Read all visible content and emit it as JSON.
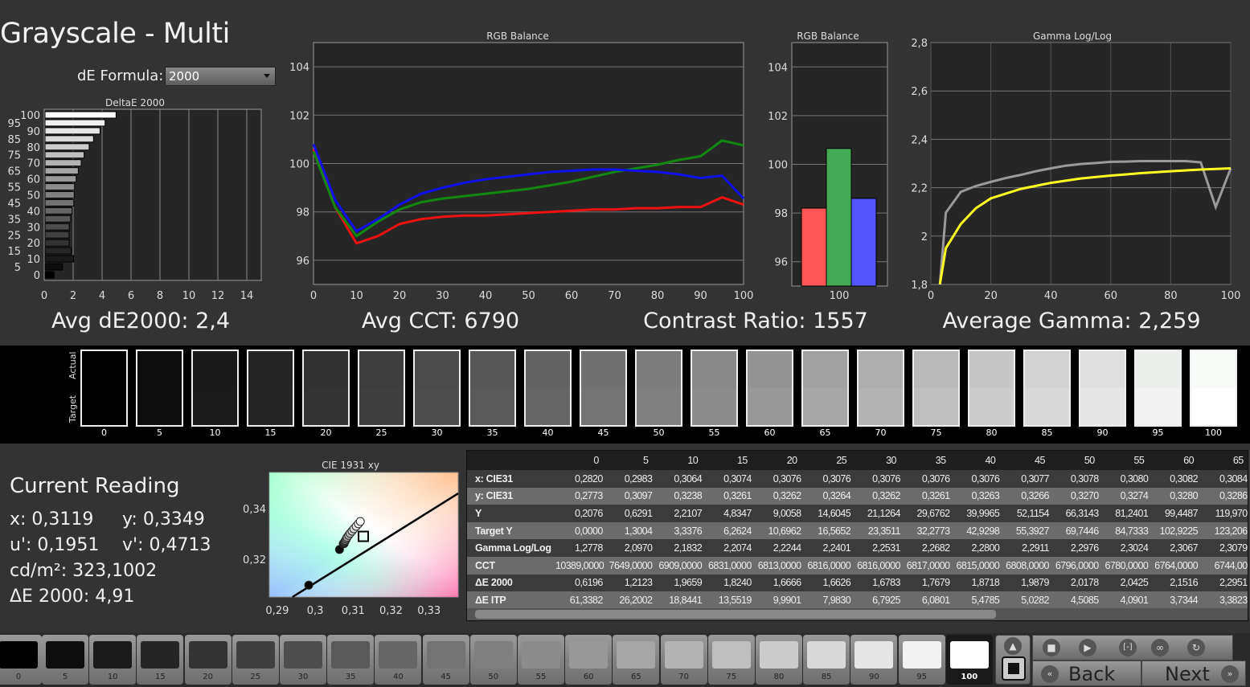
{
  "title": "Grayscale - Multi",
  "de_formula": {
    "label": "dE Formula:",
    "value": "2000"
  },
  "stats": {
    "avg_de": "Avg dE2000: 2,4",
    "avg_cct": "Avg CCT: 6790",
    "contrast": "Contrast Ratio: 1557",
    "avg_gamma": "Average Gamma: 2,259"
  },
  "colors": {
    "red": "#ee1111",
    "green": "#118811",
    "blue": "#1111ee",
    "gamma_actual": "#9a9a9a",
    "gamma_target": "#ffff22",
    "bar_red": "#ff5555",
    "bar_green": "#44aa55",
    "bar_blue": "#5555ff"
  },
  "chart_data": [
    {
      "type": "bar",
      "orientation": "horizontal",
      "title": "DeltaE 2000",
      "categories": [
        "0",
        "5",
        "10",
        "15",
        "20",
        "25",
        "30",
        "35",
        "40",
        "45",
        "50",
        "55",
        "60",
        "65",
        "70",
        "75",
        "80",
        "85",
        "90",
        "95",
        "100"
      ],
      "y_tick_labels": [
        "0",
        "5",
        "10",
        "15",
        "20",
        "25",
        "30",
        "35",
        "40",
        "45",
        "50",
        "55",
        "60",
        "65",
        "70",
        "75",
        "80",
        "85",
        "90",
        "95",
        "100"
      ],
      "values": [
        0.62,
        1.21,
        1.97,
        1.82,
        1.67,
        1.66,
        1.68,
        1.77,
        1.87,
        1.99,
        2.02,
        2.04,
        2.15,
        2.3,
        2.5,
        2.7,
        3.05,
        3.35,
        3.8,
        4.15,
        4.91
      ],
      "xlim": [
        0,
        15
      ],
      "x_ticks": [
        "0",
        "2",
        "4",
        "6",
        "8",
        "10",
        "12",
        "14"
      ],
      "grid": true
    },
    {
      "type": "line",
      "title": "RGB Balance",
      "x": [
        0,
        5,
        10,
        15,
        20,
        25,
        30,
        35,
        40,
        45,
        50,
        55,
        60,
        65,
        70,
        75,
        80,
        85,
        90,
        95,
        100
      ],
      "xlim": [
        0,
        100
      ],
      "ylim": [
        95,
        105
      ],
      "x_ticks": [
        "0",
        "10",
        "20",
        "30",
        "40",
        "50",
        "60",
        "70",
        "80",
        "90",
        "100"
      ],
      "y_ticks": [
        "96",
        "98",
        "100",
        "102",
        "104"
      ],
      "grid": true,
      "series": [
        {
          "color": "red",
          "values": [
            100.6,
            98.2,
            96.7,
            97.0,
            97.5,
            97.7,
            97.8,
            97.85,
            97.85,
            97.9,
            97.95,
            98.0,
            98.05,
            98.1,
            98.1,
            98.15,
            98.15,
            98.2,
            98.2,
            98.6,
            98.3
          ]
        },
        {
          "color": "green",
          "values": [
            100.5,
            98.2,
            97.0,
            97.6,
            98.1,
            98.4,
            98.55,
            98.65,
            98.75,
            98.85,
            98.95,
            99.1,
            99.25,
            99.45,
            99.65,
            99.8,
            99.95,
            100.15,
            100.3,
            100.95,
            100.75
          ]
        },
        {
          "color": "blue",
          "values": [
            100.8,
            98.5,
            97.2,
            97.7,
            98.3,
            98.75,
            99.0,
            99.2,
            99.35,
            99.45,
            99.55,
            99.65,
            99.7,
            99.75,
            99.75,
            99.7,
            99.65,
            99.55,
            99.4,
            99.5,
            98.55
          ]
        }
      ]
    },
    {
      "type": "bar",
      "title": "RGB Balance",
      "categories": [
        "100"
      ],
      "ylim": [
        95,
        105
      ],
      "y_ticks": [
        "96",
        "98",
        "100",
        "102",
        "104"
      ],
      "series": [
        {
          "color": "red",
          "values": [
            98.2
          ]
        },
        {
          "color": "green",
          "values": [
            100.65
          ]
        },
        {
          "color": "blue",
          "values": [
            98.6
          ]
        }
      ]
    },
    {
      "type": "line",
      "title": "Gamma Log/Log",
      "xlim": [
        0,
        100
      ],
      "ylim": [
        1.8,
        2.8
      ],
      "x_ticks": [
        "0",
        "20",
        "40",
        "60",
        "80",
        "100"
      ],
      "y_ticks": [
        "1,8",
        "2",
        "2,2",
        "2,4",
        "2,6",
        "2,8"
      ],
      "grid": true,
      "series": [
        {
          "color": "gray",
          "x": [
            3,
            5,
            10,
            15,
            20,
            25,
            30,
            35,
            40,
            45,
            50,
            55,
            60,
            65,
            70,
            75,
            80,
            85,
            90,
            95,
            100
          ],
          "values": [
            1.8,
            2.097,
            2.183,
            2.207,
            2.224,
            2.24,
            2.253,
            2.268,
            2.28,
            2.291,
            2.298,
            2.302,
            2.307,
            2.308,
            2.31,
            2.31,
            2.31,
            2.31,
            2.305,
            2.12,
            2.28
          ]
        },
        {
          "color": "yellow",
          "x": [
            3,
            5,
            10,
            15,
            20,
            30,
            40,
            50,
            60,
            70,
            80,
            90,
            100
          ],
          "values": [
            1.8,
            1.95,
            2.05,
            2.115,
            2.156,
            2.195,
            2.22,
            2.238,
            2.25,
            2.26,
            2.268,
            2.275,
            2.28
          ]
        }
      ]
    },
    {
      "type": "scatter",
      "title": "CIE 1931 xy",
      "xlim": [
        0.2879,
        0.3377
      ],
      "ylim": [
        0.305,
        0.3543
      ],
      "x_ticks": [
        "0,29",
        "0,3",
        "0,31",
        "0,32",
        "0,33"
      ],
      "y_ticks": [
        "0,32",
        "0,34"
      ],
      "points": [
        [
          0.2983,
          0.3097
        ],
        [
          0.3064,
          0.3238
        ],
        [
          0.3074,
          0.3261
        ],
        [
          0.3076,
          0.3262
        ],
        [
          0.3076,
          0.3264
        ],
        [
          0.3076,
          0.3262
        ],
        [
          0.3076,
          0.3261
        ],
        [
          0.3076,
          0.3263
        ],
        [
          0.3077,
          0.3266
        ],
        [
          0.3078,
          0.327
        ],
        [
          0.308,
          0.3274
        ],
        [
          0.3082,
          0.328
        ],
        [
          0.3084,
          0.3286
        ],
        [
          0.3088,
          0.3294
        ],
        [
          0.3092,
          0.3302
        ],
        [
          0.3097,
          0.3311
        ],
        [
          0.3102,
          0.332
        ],
        [
          0.3108,
          0.333
        ],
        [
          0.3114,
          0.334
        ],
        [
          0.3119,
          0.3349
        ]
      ],
      "target": [
        0.3127,
        0.329
      ],
      "locus": [
        [
          0.294,
          0.305
        ],
        [
          0.3377,
          0.346
        ]
      ]
    }
  ],
  "swatches": {
    "actual_label": "Actual",
    "target_label": "Target",
    "levels": [
      "0",
      "5",
      "10",
      "15",
      "20",
      "25",
      "30",
      "35",
      "40",
      "45",
      "50",
      "55",
      "60",
      "65",
      "70",
      "75",
      "80",
      "85",
      "90",
      "95",
      "100"
    ]
  },
  "current_reading": {
    "title": "Current Reading",
    "x": "x: 0,3119",
    "y": "y: 0,3349",
    "u": "u': 0,1951",
    "v": "v': 0,4713",
    "cdm2": "cd/m²: 323,1002",
    "de": "ΔE 2000: 4,91"
  },
  "table": {
    "columns": [
      "0",
      "5",
      "10",
      "15",
      "20",
      "25",
      "30",
      "35",
      "40",
      "45",
      "50",
      "55",
      "60",
      "65"
    ],
    "rows": [
      {
        "label": "x: CIE31",
        "values": [
          "0,2820",
          "0,2983",
          "0,3064",
          "0,3074",
          "0,3076",
          "0,3076",
          "0,3076",
          "0,3076",
          "0,3076",
          "0,3077",
          "0,3078",
          "0,3080",
          "0,3082",
          "0,3084"
        ]
      },
      {
        "label": "y: CIE31",
        "values": [
          "0,2773",
          "0,3097",
          "0,3238",
          "0,3261",
          "0,3262",
          "0,3264",
          "0,3262",
          "0,3261",
          "0,3263",
          "0,3266",
          "0,3270",
          "0,3274",
          "0,3280",
          "0,3286"
        ]
      },
      {
        "label": "Y",
        "values": [
          "0,2076",
          "0,6291",
          "2,2107",
          "4,8347",
          "9,0058",
          "14,6045",
          "21,1264",
          "29,6762",
          "39,9965",
          "52,1154",
          "66,3143",
          "81,2401",
          "99,4487",
          "119,970"
        ]
      },
      {
        "label": "Target Y",
        "values": [
          "0,0000",
          "1,3004",
          "3,3376",
          "6,2624",
          "10,6962",
          "16,5652",
          "23,3511",
          "32,2773",
          "42,9298",
          "55,3927",
          "69,7446",
          "84,7333",
          "102,9225",
          "123,206"
        ]
      },
      {
        "label": "Gamma Log/Log",
        "values": [
          "1,2778",
          "2,0970",
          "2,1832",
          "2,2074",
          "2,2244",
          "2,2401",
          "2,2531",
          "2,2682",
          "2,2800",
          "2,2911",
          "2,2976",
          "2,3024",
          "2,3067",
          "2,3079"
        ]
      },
      {
        "label": "CCT",
        "values": [
          "10389,0000",
          "7649,0000",
          "6909,0000",
          "6831,0000",
          "6813,0000",
          "6816,0000",
          "6816,0000",
          "6817,0000",
          "6815,0000",
          "6808,0000",
          "6796,0000",
          "6780,0000",
          "6764,0000",
          "6744,00"
        ]
      },
      {
        "label": "ΔE 2000",
        "values": [
          "0,6196",
          "1,2123",
          "1,9659",
          "1,8240",
          "1,6666",
          "1,6626",
          "1,6783",
          "1,7679",
          "1,8718",
          "1,9879",
          "2,0178",
          "2,0425",
          "2,1516",
          "2,2951"
        ]
      },
      {
        "label": "ΔE ITP",
        "values": [
          "61,3382",
          "26,2002",
          "18,8441",
          "13,5519",
          "9,9901",
          "7,9830",
          "6,7925",
          "6,0801",
          "5,4785",
          "5,0282",
          "4,5085",
          "4,0901",
          "3,7344",
          "3,3823"
        ]
      }
    ]
  },
  "toolbar": {
    "levels": [
      "0",
      "5",
      "10",
      "15",
      "20",
      "25",
      "30",
      "35",
      "40",
      "45",
      "50",
      "55",
      "60",
      "65",
      "70",
      "75",
      "80",
      "85",
      "90",
      "95",
      "100"
    ],
    "selected": "100",
    "back": "Back",
    "next": "Next"
  }
}
